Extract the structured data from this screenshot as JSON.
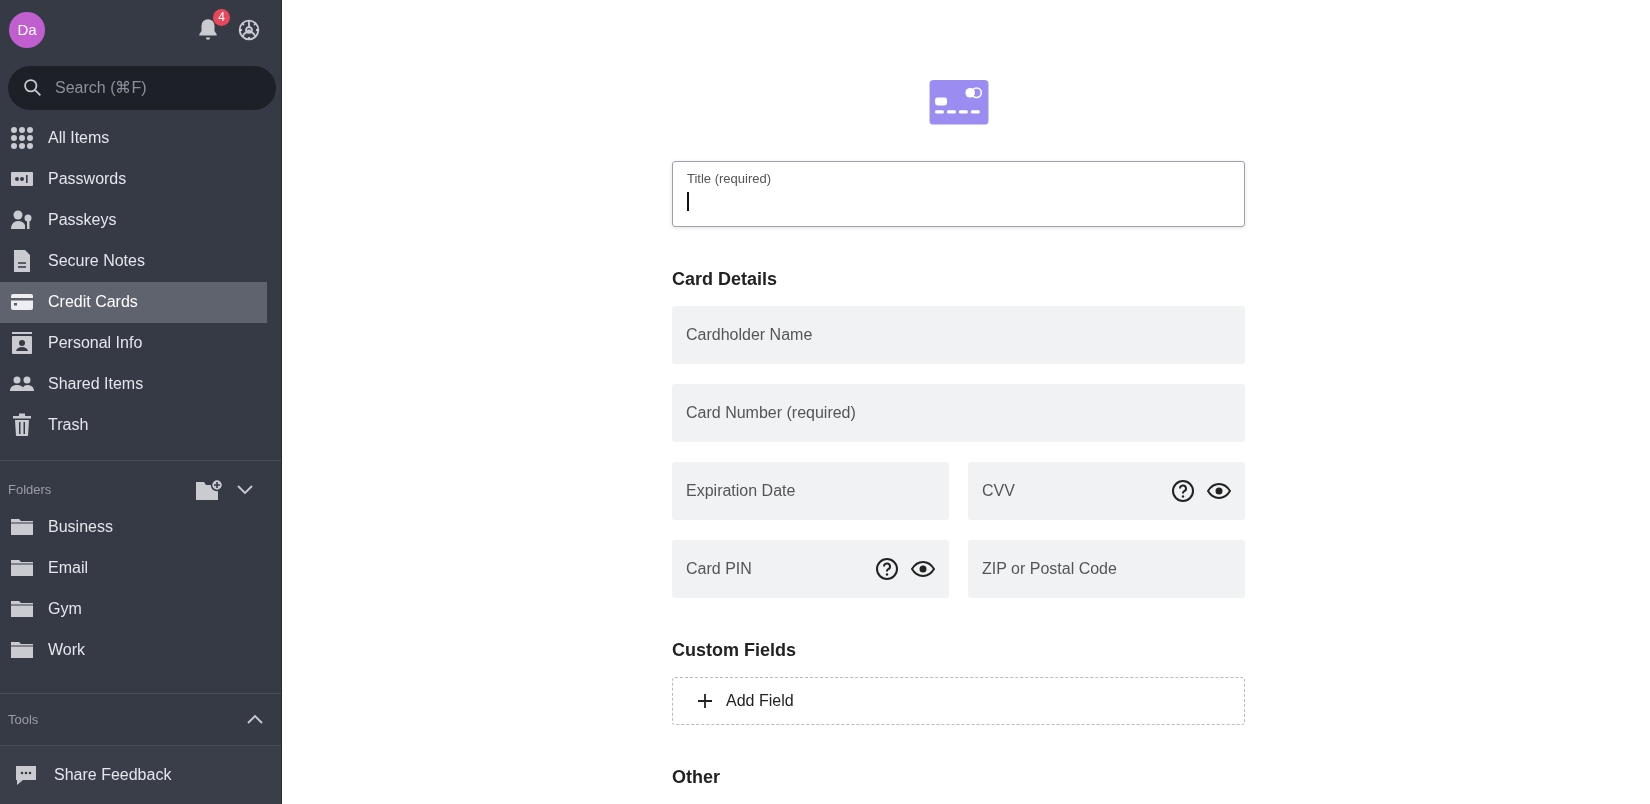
{
  "sidebar": {
    "avatar": "Da",
    "notification_count": "4",
    "search": {
      "placeholder": "Search (⌘F)"
    },
    "items": [
      {
        "label": "All Items",
        "kind": "grid",
        "selected": false
      },
      {
        "label": "Passwords",
        "kind": "password",
        "selected": false
      },
      {
        "label": "Passkeys",
        "kind": "passkey",
        "selected": false
      },
      {
        "label": "Secure Notes",
        "kind": "note",
        "selected": false
      },
      {
        "label": "Credit Cards",
        "kind": "card",
        "selected": true
      },
      {
        "label": "Personal Info",
        "kind": "person",
        "selected": false
      },
      {
        "label": "Shared Items",
        "kind": "shared",
        "selected": false
      },
      {
        "label": "Trash",
        "kind": "trash",
        "selected": false
      }
    ],
    "folders": {
      "heading": "Folders",
      "expanded": true,
      "items": [
        {
          "label": "Business",
          "selected": false
        },
        {
          "label": "Email",
          "selected": false
        },
        {
          "label": "Gym",
          "selected": false
        },
        {
          "label": "Work",
          "selected": false
        }
      ]
    },
    "tools": {
      "heading": "Tools",
      "expanded": false
    },
    "feedback": "Share Feedback"
  },
  "form": {
    "title_field": {
      "label": "Title (required)",
      "focused": true
    },
    "sections": [
      {
        "heading": "Card Details",
        "rows": [
          [
            {
              "placeholder": "Cardholder Name",
              "kind": "plain"
            }
          ],
          [
            {
              "placeholder": "Card Number (required)",
              "kind": "plain"
            }
          ],
          [
            {
              "placeholder": "Expiration Date",
              "kind": "plain"
            },
            {
              "placeholder": "CVV",
              "kind": "secret"
            }
          ],
          [
            {
              "placeholder": "Card PIN",
              "kind": "secret"
            },
            {
              "placeholder": "ZIP or Postal Code",
              "kind": "plain"
            }
          ]
        ]
      },
      {
        "heading": "Custom Fields",
        "add_label": "Add Field"
      },
      {
        "heading": "Other"
      }
    ]
  }
}
